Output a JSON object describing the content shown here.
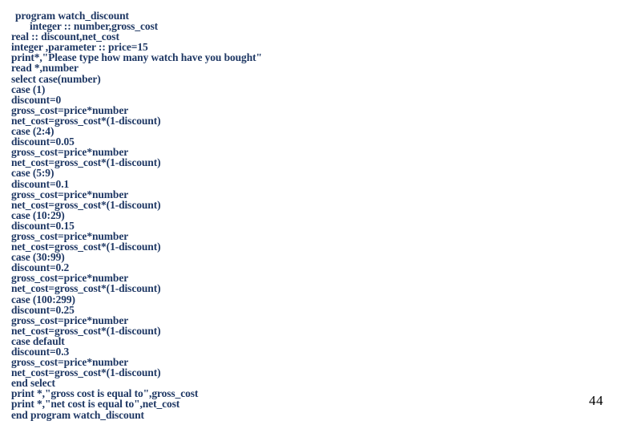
{
  "slide": {
    "page_number": "44",
    "text_color": "#1F3864",
    "page_number_color": "#000000",
    "background_color": "#FFFFFF",
    "code_lines": [
      {
        "text": "program watch_discount",
        "indent": 1
      },
      {
        "text": "integer :: number,gross_cost",
        "indent": 2
      },
      {
        "text": "real :: discount,net_cost",
        "indent": 0
      },
      {
        "text": "integer ,parameter :: price=15",
        "indent": 0
      },
      {
        "text": "print*,\"Please type how many watch have you bought\"",
        "indent": 0
      },
      {
        "text": "read *,number",
        "indent": 0
      },
      {
        "text": "select case(number)",
        "indent": 0
      },
      {
        "text": "case (1)",
        "indent": 0
      },
      {
        "text": "discount=0",
        "indent": 0
      },
      {
        "text": "gross_cost=price*number",
        "indent": 0
      },
      {
        "text": "net_cost=gross_cost*(1-discount)",
        "indent": 0
      },
      {
        "text": "case (2:4)",
        "indent": 0
      },
      {
        "text": "discount=0.05",
        "indent": 0
      },
      {
        "text": "gross_cost=price*number",
        "indent": 0
      },
      {
        "text": "net_cost=gross_cost*(1-discount)",
        "indent": 0
      },
      {
        "text": "case (5:9)",
        "indent": 0
      },
      {
        "text": "discount=0.1",
        "indent": 0
      },
      {
        "text": "gross_cost=price*number",
        "indent": 0
      },
      {
        "text": "net_cost=gross_cost*(1-discount)",
        "indent": 0
      },
      {
        "text": "case (10:29)",
        "indent": 0
      },
      {
        "text": "discount=0.15",
        "indent": 0
      },
      {
        "text": "gross_cost=price*number",
        "indent": 0
      },
      {
        "text": "net_cost=gross_cost*(1-discount)",
        "indent": 0
      },
      {
        "text": "case (30:99)",
        "indent": 0
      },
      {
        "text": "discount=0.2",
        "indent": 0
      },
      {
        "text": "gross_cost=price*number",
        "indent": 0
      },
      {
        "text": "net_cost=gross_cost*(1-discount)",
        "indent": 0
      },
      {
        "text": "case (100:299)",
        "indent": 0
      },
      {
        "text": "discount=0.25",
        "indent": 0
      },
      {
        "text": "gross_cost=price*number",
        "indent": 0
      },
      {
        "text": "net_cost=gross_cost*(1-discount)",
        "indent": 0
      },
      {
        "text": "case default",
        "indent": 0
      },
      {
        "text": "discount=0.3",
        "indent": 0
      },
      {
        "text": "gross_cost=price*number",
        "indent": 0
      },
      {
        "text": "net_cost=gross_cost*(1-discount)",
        "indent": 0
      },
      {
        "text": "end select",
        "indent": 0
      },
      {
        "text": "print *,\"gross cost is equal to\",gross_cost",
        "indent": 0
      },
      {
        "text": "print *,\"net cost is equal to\",net_cost",
        "indent": 0
      },
      {
        "text": "end program watch_discount",
        "indent": 0
      }
    ]
  }
}
